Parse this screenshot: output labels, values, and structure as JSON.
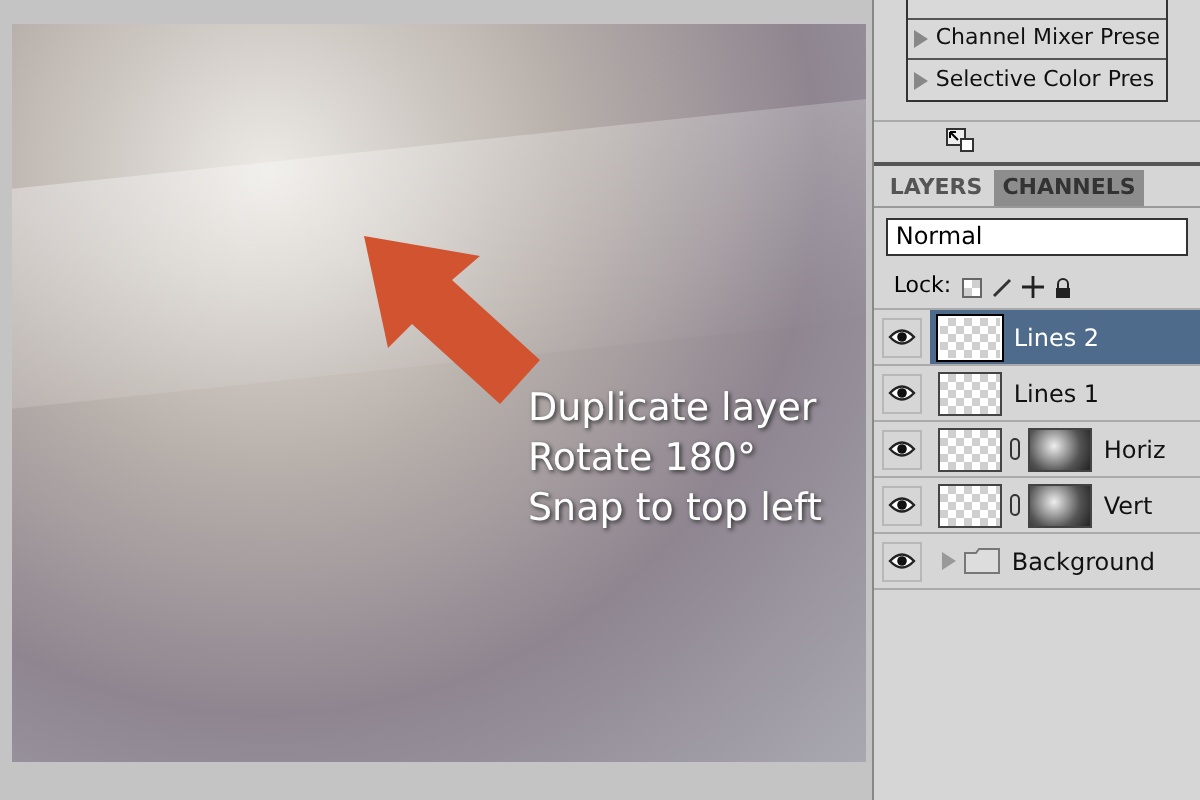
{
  "canvas": {
    "annotation": [
      "Duplicate layer",
      "Rotate 180°",
      "Snap to top left"
    ]
  },
  "presets": [
    {
      "label": "Channel Mixer Prese"
    },
    {
      "label": "Selective Color Pres"
    }
  ],
  "tabs": [
    {
      "label": "LAYERS",
      "selected": true
    },
    {
      "label": "CHANNELS",
      "selected": false
    }
  ],
  "blend_mode": {
    "value": "Normal"
  },
  "lock": {
    "label": "Lock:"
  },
  "layers": [
    {
      "kind": "layer",
      "name": "Lines 2",
      "selected": true,
      "visible": true,
      "mask": false
    },
    {
      "kind": "layer",
      "name": "Lines 1",
      "selected": false,
      "visible": true,
      "mask": false
    },
    {
      "kind": "layer",
      "name": "Horiz",
      "selected": false,
      "visible": true,
      "mask": true
    },
    {
      "kind": "layer",
      "name": "Vert",
      "selected": false,
      "visible": true,
      "mask": true
    },
    {
      "kind": "group",
      "name": "Background",
      "selected": false,
      "visible": true
    }
  ]
}
